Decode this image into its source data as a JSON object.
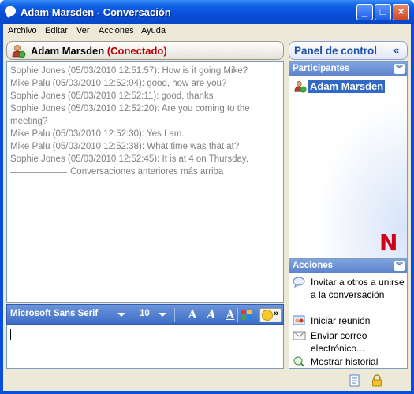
{
  "window": {
    "title": "Adam Marsden - Conversación",
    "controls": {
      "minimize": "_",
      "maximize": "□",
      "close": "×"
    }
  },
  "menu": [
    "Archivo",
    "Editar",
    "Ver",
    "Acciones",
    "Ayuda"
  ],
  "conversation": {
    "contact_name": "Adam Marsden",
    "status": "(Conectado)",
    "messages": [
      "Sophie Jones  (05/03/2010 12:51:57): How is it going Mike?",
      "Mike Palu  (05/03/2010 12:52:04): good, how are you?",
      "Sophie Jones  (05/03/2010 12:52:11): good, thanks",
      "Sophie Jones  (05/03/2010 12:52:20): Are you coming to the meeting?",
      "Mike Palu  (05/03/2010 12:52:30): Yes I am.",
      "Mike Palu  (05/03/2010 12:52:38): What time was that at?",
      "Sophie Jones  (05/03/2010 12:52:45): It is at 4 on Thursday."
    ],
    "older_divider": "Conversaciones anteriores más arriba"
  },
  "format_toolbar": {
    "font": "Microsoft Sans Serif",
    "size": "10",
    "bold": "A",
    "italic": "A",
    "underline": "A",
    "more": "»"
  },
  "input": {
    "value": ""
  },
  "panel": {
    "title": "Panel de control",
    "collapse": "«",
    "participants_header": "Participantes",
    "participants": [
      "Adam Marsden"
    ],
    "actions_header": "Acciones",
    "actions": [
      {
        "label": "Invitar a otros a unirse a la conversación",
        "icon": "invite-icon"
      },
      {
        "label": "Iniciar reunión",
        "icon": "meeting-icon"
      },
      {
        "label": "Enviar correo electrónico...",
        "icon": "email-icon"
      },
      {
        "label": "Mostrar historial",
        "icon": "history-icon"
      }
    ],
    "section_toggle": "︾",
    "logo": "N"
  },
  "colors": {
    "title_bar": "#0a4fd8",
    "status_online": "#c00000",
    "panel_title": "#1d4fa6",
    "selection": "#316ac5",
    "logo": "#d0021b"
  },
  "statusbar_icons": [
    "history-log-icon",
    "lock-icon"
  ]
}
